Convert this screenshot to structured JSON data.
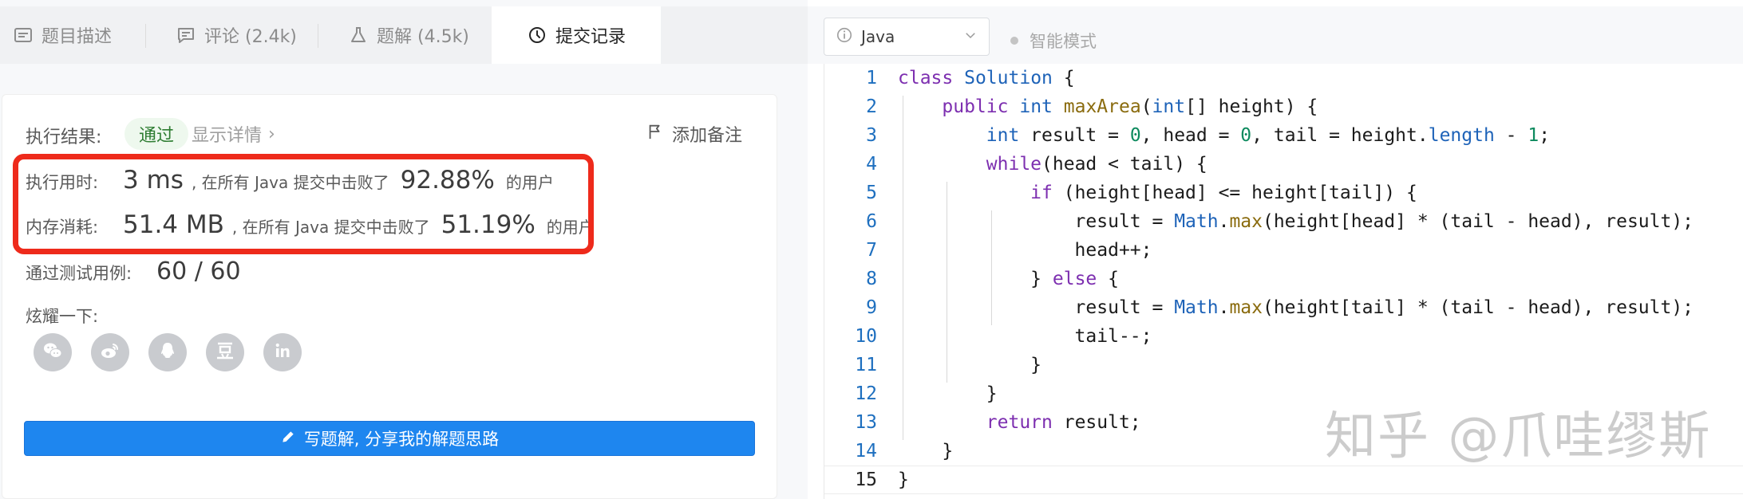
{
  "tabs": [
    {
      "label": "题目描述",
      "icon": "description-icon"
    },
    {
      "label": "评论 (2.4k)",
      "icon": "comment-icon"
    },
    {
      "label": "题解 (4.5k)",
      "icon": "flask-icon"
    },
    {
      "label": "提交记录",
      "icon": "clock-icon",
      "active": true
    }
  ],
  "result": {
    "label": "执行结果:",
    "status": "通过",
    "details": "显示详情",
    "add_note": "添加备注"
  },
  "runtime": {
    "label": "执行用时:",
    "value": "3 ms",
    "middle": ", 在所有 Java 提交中击败了",
    "percent": "92.88%",
    "suffix": "的用户"
  },
  "memory": {
    "label": "内存消耗:",
    "value": "51.4 MB",
    "middle": ", 在所有 Java 提交中击败了",
    "percent": "51.19%",
    "suffix": "的用户"
  },
  "tests": {
    "label": "通过测试用例:",
    "value": "60 / 60"
  },
  "share": {
    "label": "炫耀一下:",
    "items": [
      "wechat-icon",
      "weibo-icon",
      "qq-icon",
      "douban-icon",
      "linkedin-icon"
    ]
  },
  "write_button": "写题解, 分享我的解题思路",
  "editor": {
    "language": "Java",
    "smart_mode": "智能模式"
  },
  "colors": {
    "accent": "#1e86ef",
    "highlight_border": "#ee2a1b",
    "keyword": "#7d2fb0",
    "type": "#1e63b8",
    "number": "#0d8a5e",
    "method": "#8a6b0e"
  },
  "code": [
    {
      "n": "1",
      "tokens": [
        [
          "kw",
          "class"
        ],
        [
          "t",
          " "
        ],
        [
          "type",
          "Solution"
        ],
        [
          "t",
          " {"
        ]
      ]
    },
    {
      "n": "2",
      "tokens": [
        [
          "t",
          "    "
        ],
        [
          "kw",
          "public"
        ],
        [
          "t",
          " "
        ],
        [
          "type",
          "int"
        ],
        [
          "t",
          " "
        ],
        [
          "method",
          "maxArea"
        ],
        [
          "t",
          "("
        ],
        [
          "type",
          "int"
        ],
        [
          "t",
          "[] height) {"
        ]
      ]
    },
    {
      "n": "3",
      "tokens": [
        [
          "t",
          "        "
        ],
        [
          "type",
          "int"
        ],
        [
          "t",
          " result = "
        ],
        [
          "num",
          "0"
        ],
        [
          "t",
          ", head = "
        ],
        [
          "num",
          "0"
        ],
        [
          "t",
          ", tail = height."
        ],
        [
          "type",
          "length"
        ],
        [
          "t",
          " - "
        ],
        [
          "num",
          "1"
        ],
        [
          "t",
          ";"
        ]
      ]
    },
    {
      "n": "4",
      "tokens": [
        [
          "t",
          "        "
        ],
        [
          "kw",
          "while"
        ],
        [
          "t",
          "(head < tail) {"
        ]
      ]
    },
    {
      "n": "5",
      "tokens": [
        [
          "t",
          "            "
        ],
        [
          "kw",
          "if"
        ],
        [
          "t",
          " (height[head] <= height[tail]) {"
        ]
      ]
    },
    {
      "n": "6",
      "tokens": [
        [
          "t",
          "                result = "
        ],
        [
          "type",
          "Math"
        ],
        [
          "t",
          "."
        ],
        [
          "method",
          "max"
        ],
        [
          "t",
          "(height[head] * (tail - head), result);"
        ]
      ]
    },
    {
      "n": "7",
      "tokens": [
        [
          "t",
          "                head++;"
        ]
      ]
    },
    {
      "n": "8",
      "tokens": [
        [
          "t",
          "            } "
        ],
        [
          "kw",
          "else"
        ],
        [
          "t",
          " {"
        ]
      ]
    },
    {
      "n": "9",
      "tokens": [
        [
          "t",
          "                result = "
        ],
        [
          "type",
          "Math"
        ],
        [
          "t",
          "."
        ],
        [
          "method",
          "max"
        ],
        [
          "t",
          "(height[tail] * (tail - head), result);"
        ]
      ]
    },
    {
      "n": "10",
      "tokens": [
        [
          "t",
          "                tail--;"
        ]
      ]
    },
    {
      "n": "11",
      "tokens": [
        [
          "t",
          "            }"
        ]
      ]
    },
    {
      "n": "12",
      "tokens": [
        [
          "t",
          "        }"
        ]
      ]
    },
    {
      "n": "13",
      "tokens": [
        [
          "t",
          "        "
        ],
        [
          "kw",
          "return"
        ],
        [
          "t",
          " result;"
        ]
      ]
    },
    {
      "n": "14",
      "tokens": [
        [
          "t",
          "    }"
        ]
      ]
    },
    {
      "n": "15",
      "tokens": [
        [
          "t",
          "}"
        ]
      ],
      "current": true
    }
  ],
  "watermark": "知乎 @爪哇缪斯"
}
